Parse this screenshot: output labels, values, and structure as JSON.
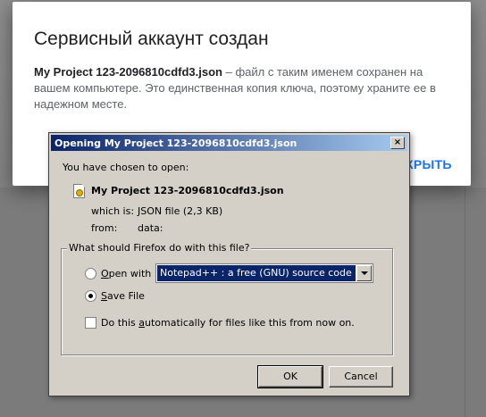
{
  "background_dialog": {
    "title": "Сервисный аккаунт создан",
    "filename": "My Project 123-2096810cdfd3.json",
    "message": " – файл с таким именем сохранен на вашем компьютере. Это единственная копия ключа, поэтому храните ее в надежном месте.",
    "close_label": "КРЫТЬ"
  },
  "download_dialog": {
    "title": "Opening My Project 123-2096810cdfd3.json",
    "close_glyph": "×",
    "intro": "You have chosen to open:",
    "filename": "My Project 123-2096810cdfd3.json",
    "which_is_label": "which is:",
    "which_is_value": "JSON file (2,3 KB)",
    "from_label": "from:",
    "from_value": "data:",
    "group_label": "What should Firefox do with this file?",
    "open_with": {
      "label_accel": "O",
      "label_rest": "pen with",
      "selected": false,
      "app_value": "Notepad++ : a free (GNU) source code edit..."
    },
    "save_file": {
      "label_accel": "S",
      "label_rest": "ave File",
      "selected": true
    },
    "auto_checkbox": {
      "label_pre": "Do this ",
      "label_accel": "a",
      "label_post": "utomatically for files like this from now on.",
      "checked": false
    },
    "ok_label": "OK",
    "cancel_label": "Cancel"
  },
  "colors": {
    "accent": "#1a73e8",
    "titlebar_start": "#0a246a",
    "titlebar_end": "#a6caf0",
    "dialog_face": "#d4d0c8"
  },
  "icons": {
    "file": "json-file-icon",
    "close": "close-icon",
    "dropdown": "chevron-down-icon"
  }
}
